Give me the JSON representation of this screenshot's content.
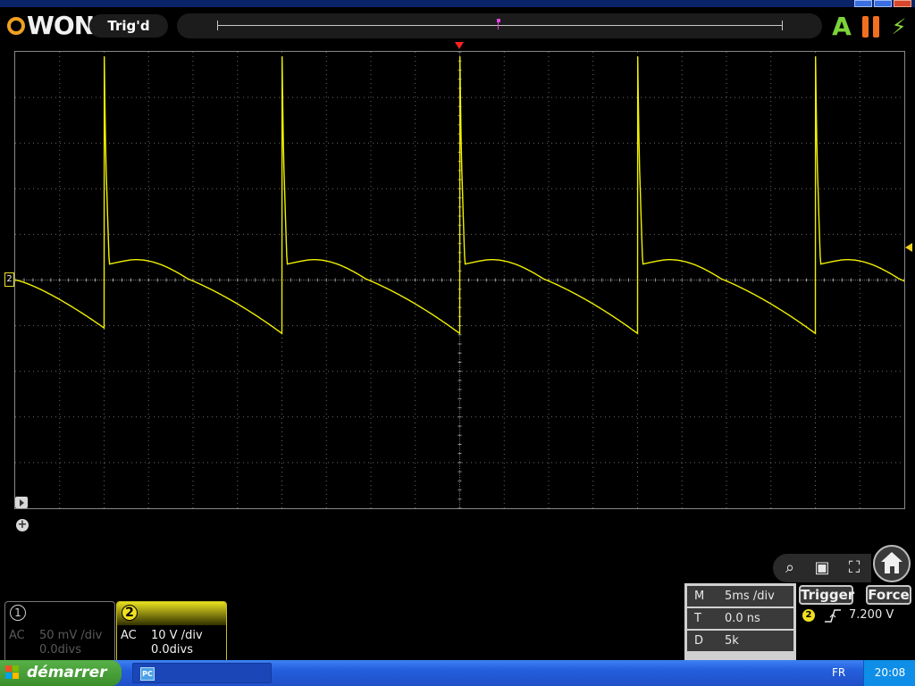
{
  "header": {
    "brand": "WON",
    "trigger_status": "Trig'd",
    "auto_label": "A",
    "force_symbol": "⚡"
  },
  "channels": [
    {
      "number": "1",
      "coupling": "AC",
      "scale": "50 mV /div",
      "offset": "0.0divs",
      "active": false
    },
    {
      "number": "2",
      "coupling": "AC",
      "scale": "10 V /div",
      "offset": "0.0divs",
      "active": true
    }
  ],
  "horizontal": {
    "rows": [
      {
        "key": "M",
        "value": "5ms /div"
      },
      {
        "key": "T",
        "value": "0.0 ns"
      },
      {
        "key": "D",
        "value": "5k"
      }
    ]
  },
  "trigger": {
    "trigger_label": "Trigger",
    "force_label": "Force",
    "source": "2",
    "level": "7.200 V"
  },
  "screen": {
    "ch2_marker": "2",
    "add_symbol": "+"
  },
  "taskbar": {
    "start_label": "démarrer",
    "task_icon_text": "PC",
    "language": "FR",
    "clock": "20:08"
  },
  "colors": {
    "trace": "#f0f000",
    "grid": "#6a6a6a",
    "accent": "#f0a020"
  },
  "icons": [
    "auto-icon",
    "pause-icon",
    "bolt-icon",
    "zoom-icon",
    "save-icon",
    "fit-icon",
    "home-icon"
  ],
  "waveform": {
    "channel": "2",
    "period_divs": 4.0,
    "first_spike_div": 2.0,
    "spike_peak_div": 4.9,
    "dip_min_div": -1.05,
    "plateau_div": 0.35,
    "start_level_div": 0.0
  }
}
